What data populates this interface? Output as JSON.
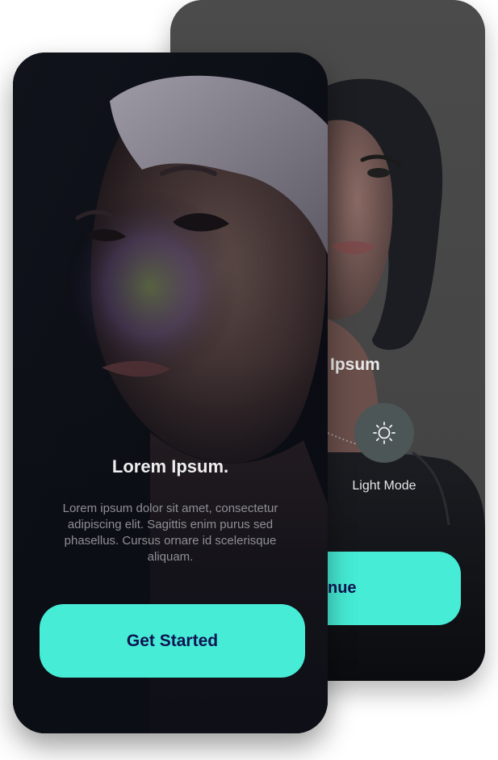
{
  "front_screen": {
    "title": "Lorem Ipsum.",
    "body": "Lorem ipsum dolor sit amet, consectetur adipiscing elit. Sagittis enim purus sed phasellus. Cursus ornare id scelerisque aliquam.",
    "cta_label": "Get Started"
  },
  "back_screen": {
    "title_visible": "Ipsum",
    "mode_icon": "sun-icon",
    "mode_label": "Light Mode",
    "cta_label_visible": "inue"
  },
  "colors": {
    "accent": "#46ecd5",
    "button_text": "#0e1352",
    "back_card": "#4a4a4a",
    "front_card": "#0c0e16"
  }
}
